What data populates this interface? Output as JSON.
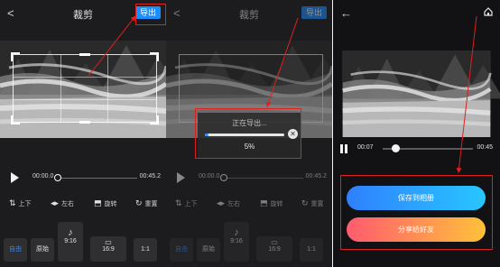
{
  "screen1": {
    "back": "<",
    "title": "裁剪",
    "export_label": "导出",
    "time_start": "00:00.0",
    "time_end": "00:45.2",
    "tools": [
      {
        "icon": "flip-vertical-icon",
        "glyph": "⇅",
        "label": "上下"
      },
      {
        "icon": "flip-horizontal-icon",
        "glyph": "◂▸",
        "label": "左右"
      },
      {
        "icon": "rotate-icon",
        "glyph": "⬒",
        "label": "旋转"
      },
      {
        "icon": "reset-icon",
        "glyph": "↻",
        "label": "重置"
      }
    ],
    "ratios": [
      "自由",
      "原始",
      "9:16",
      "16:9",
      "1:1"
    ]
  },
  "screen2": {
    "back": "<",
    "title": "裁剪",
    "export_label": "导出",
    "progress_label": "正在导出...",
    "progress_percent": "5%",
    "progress_value": 0.05,
    "time_start": "00:00.0",
    "time_end": "00:45.2",
    "tools": [
      "上下",
      "左右",
      "旋转",
      "重置"
    ],
    "ratios": [
      "自由",
      "原始",
      "9:16",
      "16:9",
      "1:1"
    ]
  },
  "screen3": {
    "back": "←",
    "time_current": "00:07",
    "time_total": "00:45",
    "playback_progress": 0.1,
    "save_label": "保存到相册",
    "share_label": "分享给好友"
  },
  "colors": {
    "accent": "#1b8dff",
    "annotation": "#e0201c",
    "share_gradient": [
      "#ff5b6f",
      "#ffc13a"
    ],
    "save_gradient": [
      "#2f80ff",
      "#28c6ff"
    ]
  }
}
